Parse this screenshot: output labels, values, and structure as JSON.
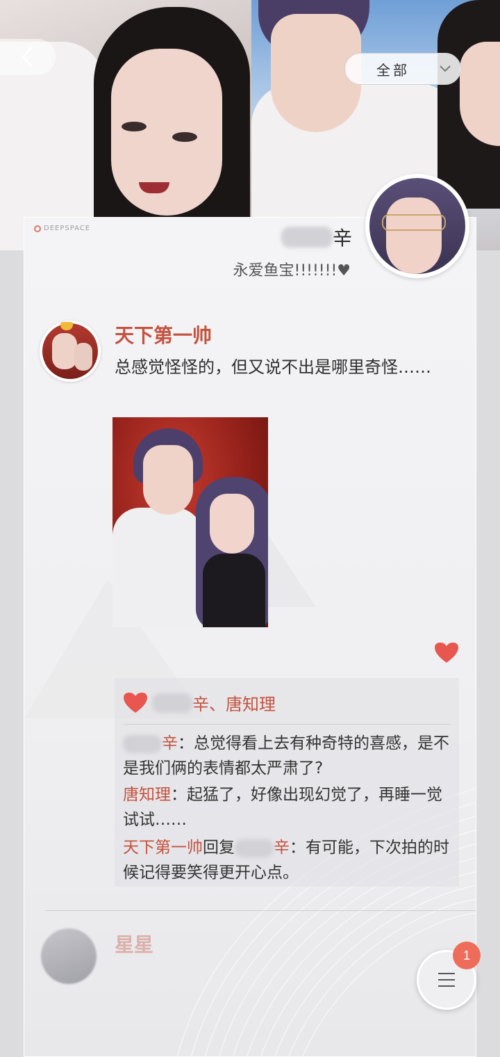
{
  "header": {
    "back_icon": "chevron-left-icon",
    "filter": {
      "label": "全部",
      "icon": "chevron-down-icon"
    }
  },
  "card": {
    "brand": "DEEPSPACE",
    "owner": {
      "name_suffix": "辛",
      "signature": "永爱鱼宝!!!!!!!♥"
    },
    "post": {
      "author": "天下第一帅",
      "text": "总感觉怪怪的，但又说不出是哪里奇怪……"
    },
    "likes": {
      "suffix": "辛、唐知理"
    },
    "comments": [
      {
        "name_suffix": "辛",
        "text": "：总觉得看上去有种奇特的喜感，是不是我们俩的表情都太严肃了?"
      },
      {
        "name": "唐知理",
        "text": "：起猛了，好像出现幻觉了，再睡一觉试试……"
      },
      {
        "name": "天下第一帅",
        "reply_word": "回复",
        "reply_target_suffix": "辛",
        "text": "：有可能，下次拍的时候记得要笑得更开心点。"
      }
    ],
    "next_post": {
      "author": "星星"
    }
  },
  "menu": {
    "badge": "1",
    "icon": "menu-lines-icon"
  },
  "colors": {
    "accent": "#c4533f",
    "heart": "#e8574f",
    "badge": "#ee6d5a"
  }
}
